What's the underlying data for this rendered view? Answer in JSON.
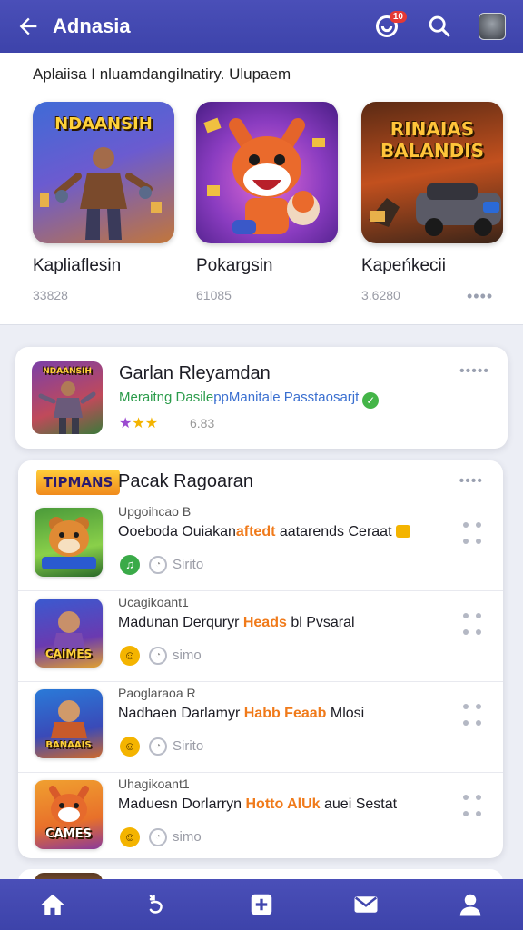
{
  "header": {
    "title": "Adnasia",
    "notification_badge": "10"
  },
  "featured": {
    "subtitle": "Aplaiisa I nluamdangiInatiry. Ulupaem",
    "cards": [
      {
        "name": "Kapliaflesin",
        "meta": "33828",
        "art_text": "NDAANSIH"
      },
      {
        "name": "Pokargsin",
        "meta": "61085",
        "art_text": ""
      },
      {
        "name": "Kapeńkecii",
        "meta": "3.6280",
        "art_text": "RINAIAS BALANDIS"
      }
    ],
    "more": "••••"
  },
  "highlight": {
    "title": "Garlan Rleyamdan",
    "desc_green": "Meraitng Dasile",
    "desc_blue": "ppManitale Passtaosarjt",
    "rating": "6.83",
    "more": "•••••",
    "thumb_text": "NDAANSIH"
  },
  "list": {
    "logo": "TIPMANS",
    "title": "Pacak Ragoaran",
    "more": "••••",
    "rows": [
      {
        "sub": "Upgoihcao B",
        "main_a": "Ooeboda Ouiakan",
        "hot": "aftedt",
        "main_b": " aatarends Ceraat",
        "meta": "Sirito",
        "thumb_text": ""
      },
      {
        "sub": "Ucagikoant1",
        "main_a": "Madunan Derquryr ",
        "hot": "Heads",
        "main_b": " bl Pvsaral",
        "meta": "simo",
        "thumb_text": "CAIMES"
      },
      {
        "sub": "Paoglaraoa R",
        "main_a": "Nadhaen Darlamyr ",
        "hot": "Habb Feaab",
        "main_b": " Mlosi",
        "meta": "Sirito",
        "thumb_text": "BANAAIS"
      },
      {
        "sub": "Uhagikoant1",
        "main_a": "Maduesn Dorlarryn ",
        "hot": "Hotto AlUk",
        "main_b": " auei Sestat",
        "meta": "simo",
        "thumb_text": "CAMES"
      }
    ]
  },
  "colors": {
    "primary": "#4046ad",
    "accent_green": "#2a9b4a",
    "accent_orange": "#f07a1a",
    "star": "#f4b400"
  }
}
